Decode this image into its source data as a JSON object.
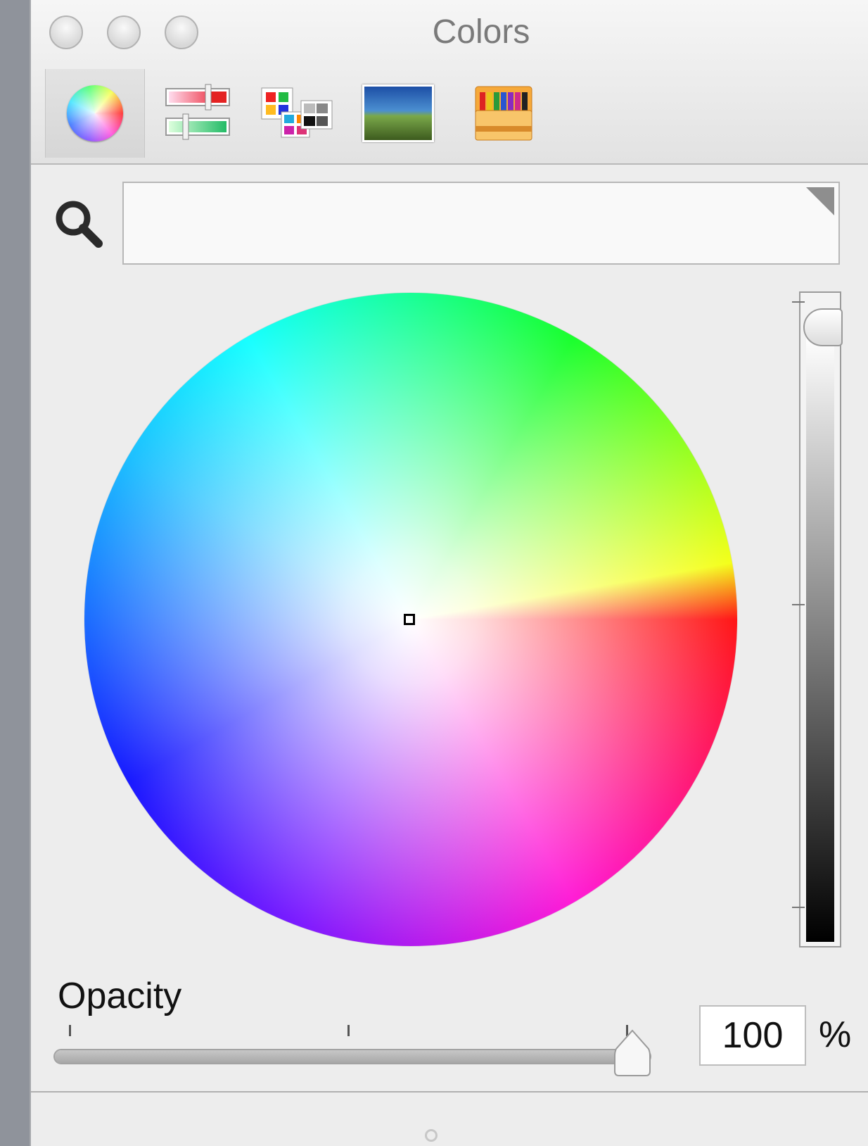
{
  "window": {
    "title": "Colors",
    "controls": [
      "close",
      "minimize",
      "zoom"
    ]
  },
  "toolbar": {
    "modes": [
      {
        "name": "color-wheel",
        "icon": "color-wheel-icon",
        "selected": true
      },
      {
        "name": "color-sliders",
        "icon": "sliders-icon",
        "selected": false
      },
      {
        "name": "color-palettes",
        "icon": "palettes-icon",
        "selected": false
      },
      {
        "name": "image-palettes",
        "icon": "image-palette-icon",
        "selected": false
      },
      {
        "name": "crayons",
        "icon": "crayons-icon",
        "selected": false
      }
    ]
  },
  "search": {
    "icon": "search-icon",
    "value": "",
    "placeholder": ""
  },
  "color_wheel": {
    "selected_color": "#ffffff"
  },
  "brightness": {
    "value": 1.0
  },
  "opacity": {
    "label": "Opacity",
    "value": "100",
    "unit": "%",
    "level": 1.0
  }
}
